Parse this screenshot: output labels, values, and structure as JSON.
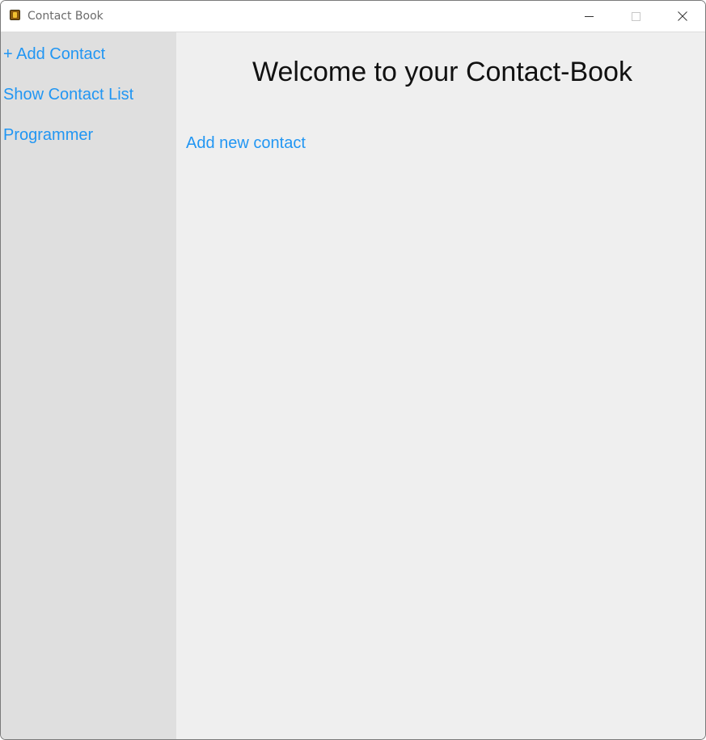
{
  "window": {
    "title": "Contact Book"
  },
  "sidebar": {
    "items": [
      {
        "label": "+ Add Contact"
      },
      {
        "label": "Show Contact List"
      },
      {
        "label": "Programmer"
      }
    ]
  },
  "main": {
    "heading": "Welcome to your Contact-Book",
    "link": "Add new contact"
  },
  "colors": {
    "link": "#2196f3",
    "sidebar_bg": "#dfdfdf",
    "main_bg": "#efefef"
  },
  "icons": {
    "app": "contact-book-app-icon",
    "minimize": "minimize-icon",
    "maximize": "maximize-icon",
    "close": "close-icon"
  }
}
